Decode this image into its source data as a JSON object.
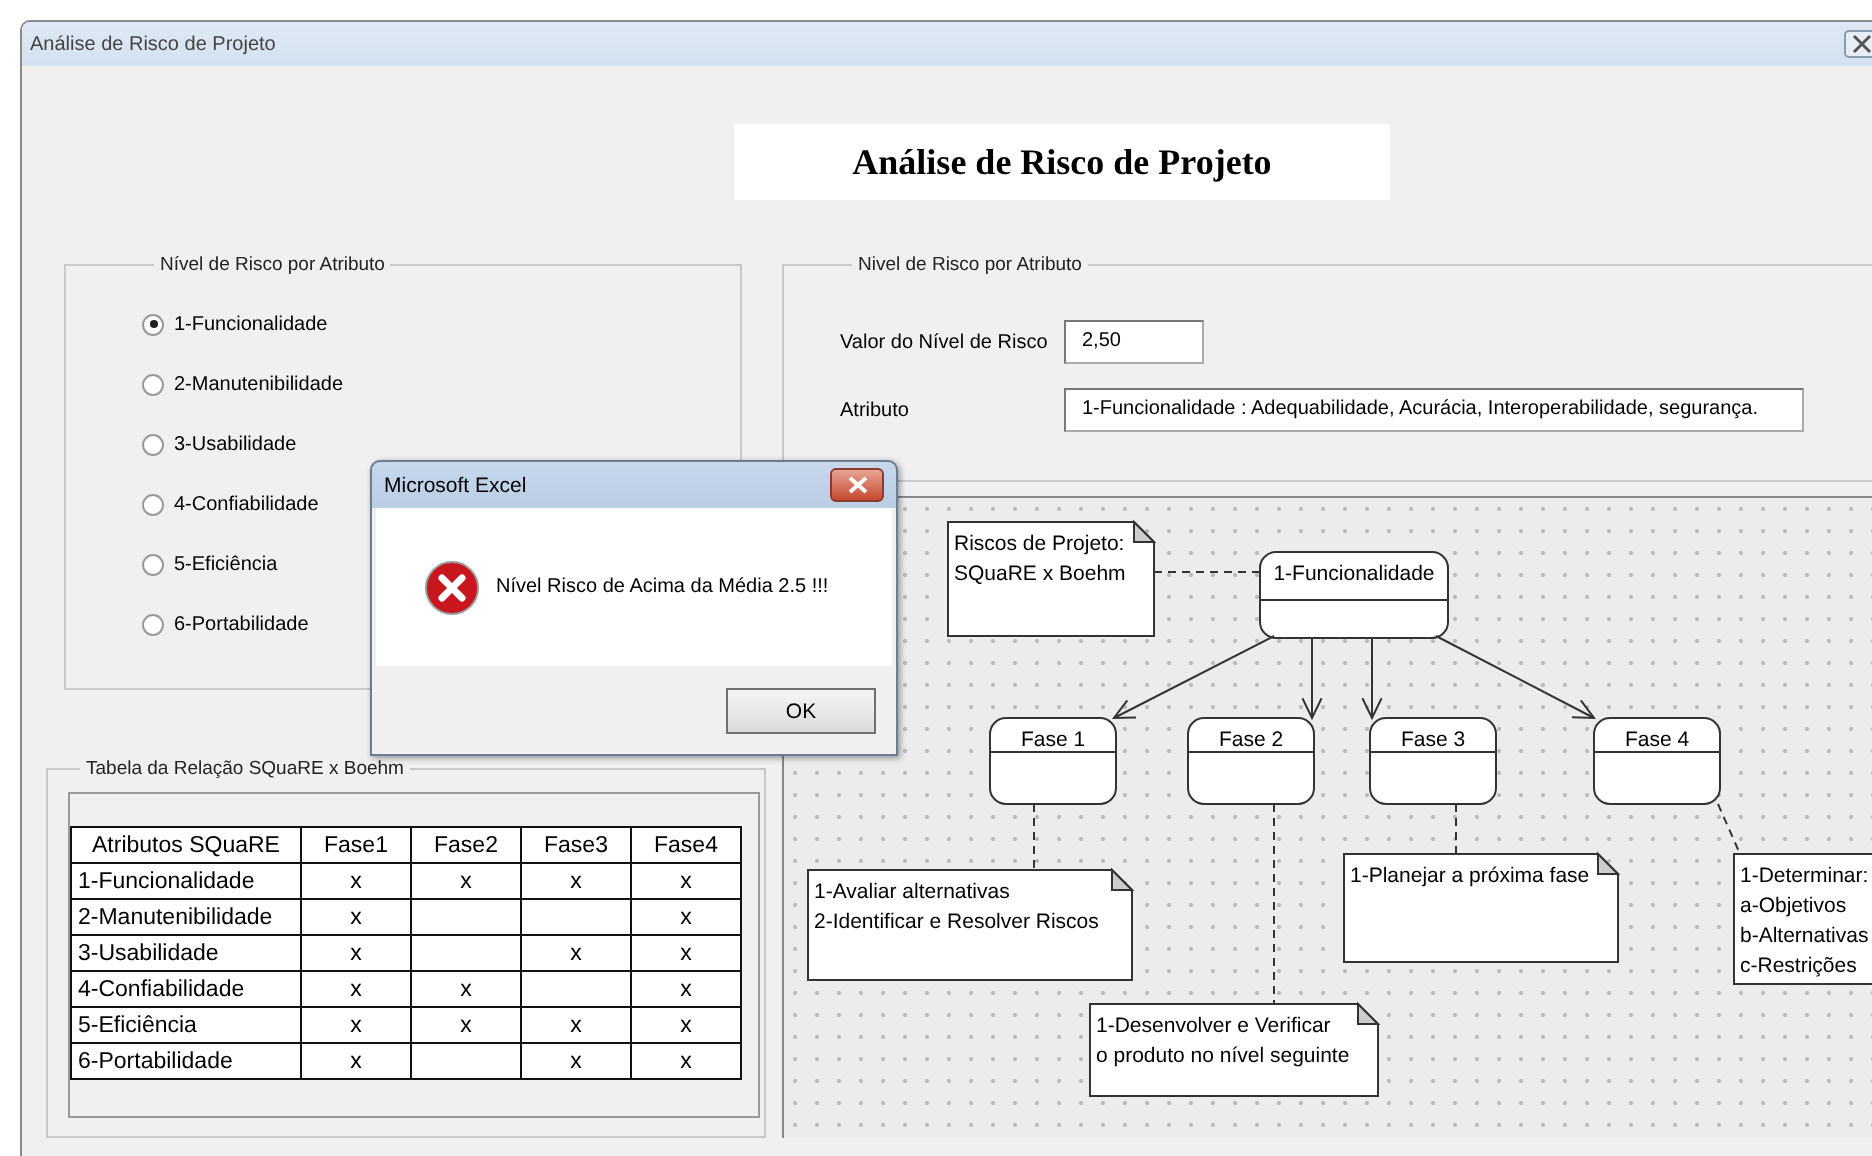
{
  "window": {
    "title": "Análise de Risco de Projeto"
  },
  "heading": "Análise de Risco de Projeto",
  "attribute_panel": {
    "title": "Nível de Risco por Atributo",
    "options": [
      {
        "label": "1-Funcionalidade",
        "selected": true
      },
      {
        "label": "2-Manutenibilidade",
        "selected": false
      },
      {
        "label": "3-Usabilidade",
        "selected": false
      },
      {
        "label": "4-Confiabilidade",
        "selected": false
      },
      {
        "label": "5-Eficiência",
        "selected": false
      },
      {
        "label": "6-Portabilidade",
        "selected": false
      }
    ]
  },
  "risk_panel": {
    "title": "Nivel de Risco por Atributo",
    "fields": [
      {
        "label": "Valor do Nível de Risco",
        "value": "2,50"
      },
      {
        "label": "Atributo",
        "value": "1-Funcionalidade : Adequabilidade, Acurácia, Interoperabilidade, segurança."
      }
    ]
  },
  "diagram": {
    "title_note": [
      "Riscos de Projeto:",
      "SQuaRE x Boehm"
    ],
    "root": "1-Funcionalidade",
    "phases": [
      {
        "name": "Fase 1",
        "note": [
          "1-Avaliar alternativas",
          "2-Identificar e Resolver Riscos"
        ]
      },
      {
        "name": "Fase 2",
        "note": [
          "1-Desenvolver e Verificar",
          "o produto no nível seguinte"
        ]
      },
      {
        "name": "Fase 3",
        "note": [
          "1-Planejar a próxima fase"
        ]
      },
      {
        "name": "Fase 4",
        "note": [
          "1-Determinar:",
          "a-Objetivos",
          "b-Alternativas",
          "c-Restrições"
        ]
      }
    ]
  },
  "table_panel": {
    "title": "Tabela da Relação SQuaRE x Boehm",
    "columns": [
      "Atributos SQuaRE",
      "Fase1",
      "Fase2",
      "Fase3",
      "Fase4"
    ],
    "rows": [
      {
        "cells": [
          "1-Funcionalidade",
          "x",
          "x",
          "x",
          "x"
        ]
      },
      {
        "cells": [
          "2-Manutenibilidade",
          "x",
          "",
          "",
          "x"
        ]
      },
      {
        "cells": [
          "3-Usabilidade",
          "x",
          "",
          "x",
          "x"
        ]
      },
      {
        "cells": [
          "4-Confiabilidade",
          "x",
          "x",
          "",
          "x"
        ]
      },
      {
        "cells": [
          "5-Eficiência",
          "x",
          "x",
          "x",
          "x"
        ]
      },
      {
        "cells": [
          "6-Portabilidade",
          "x",
          "",
          "x",
          "x"
        ]
      }
    ]
  },
  "dialog": {
    "title": "Microsoft Excel",
    "message": "Nível Risco de Acima da Média 2.5 !!!",
    "buttons": [
      "OK"
    ]
  }
}
